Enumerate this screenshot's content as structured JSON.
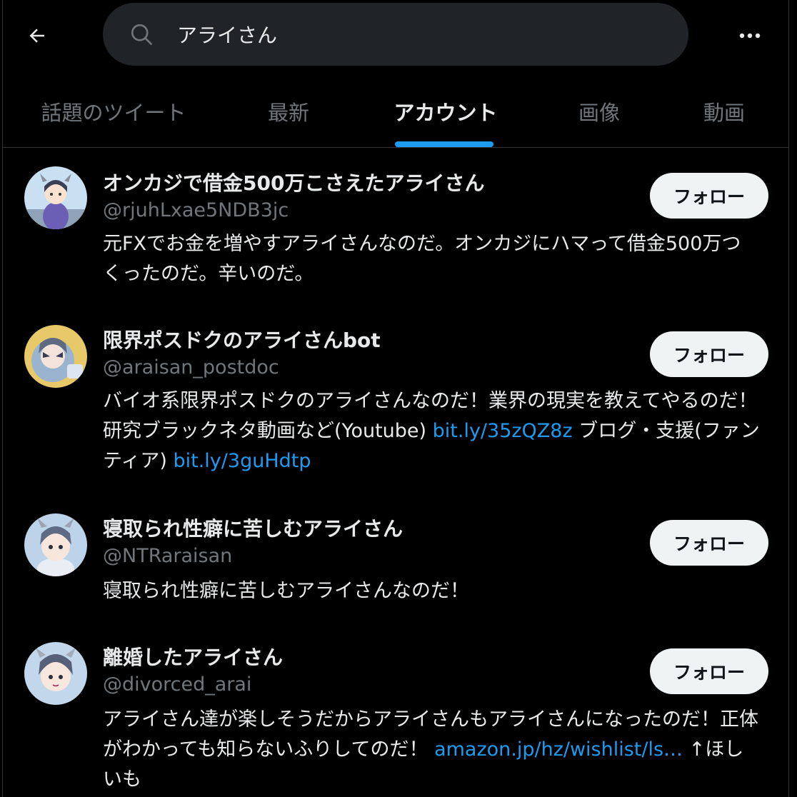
{
  "header": {
    "back_icon": "arrow-left-icon",
    "search_icon": "search-icon",
    "search_value": "アライさん",
    "more_icon": "more-horizontal-icon"
  },
  "tabs": [
    {
      "label": "話題のツイート",
      "active": false
    },
    {
      "label": "最新",
      "active": false
    },
    {
      "label": "アカウント",
      "active": true
    },
    {
      "label": "画像",
      "active": false
    },
    {
      "label": "動画",
      "active": false
    }
  ],
  "colors": {
    "background": "#000000",
    "accent": "#1d9bf0",
    "text_primary": "#e7e9ea",
    "text_secondary": "#71767b",
    "follow_button_bg": "#eff3f4"
  },
  "users": [
    {
      "name": "オンカジで借金500万こさえたアライさん",
      "handle": "@rjuhLxae5NDB3jc",
      "bio": [
        {
          "text": "元FXでお金を増やすアライさんなのだ。オンカジにハマって借金500万つくったのだ。辛いのだ。",
          "link": false
        }
      ],
      "follow_label": "フォロー"
    },
    {
      "name": "限界ポスドクのアライさんbot",
      "handle": "@araisan_postdoc",
      "bio": [
        {
          "text": "バイオ系限界ポスドクのアライさんなのだ！業界の現実を教えてやるのだ！ 研究ブラックネタ動画など(Youtube) ",
          "link": false
        },
        {
          "text": "bit.ly/35zQZ8z",
          "link": true
        },
        {
          "text": " ブログ・支援(ファンティア) ",
          "link": false
        },
        {
          "text": "bit.ly/3guHdtp",
          "link": true
        }
      ],
      "follow_label": "フォロー"
    },
    {
      "name": "寝取られ性癖に苦しむアライさん",
      "handle": "@NTRaraisan",
      "bio": [
        {
          "text": "寝取られ性癖に苦しむアライさんなのだ！",
          "link": false
        }
      ],
      "follow_label": "フォロー"
    },
    {
      "name": "離婚したアライさん",
      "handle": "@divorced_arai",
      "bio": [
        {
          "text": "アライさん達が楽しそうだからアライさんもアライさんになったのだ！正体がわかっても知らないふりしてのだ！ ",
          "link": false
        },
        {
          "text": "amazon.jp/hz/wishlist/ls…",
          "link": true
        },
        {
          "text": " ↑ほしいも",
          "link": false
        }
      ],
      "follow_label": "フォロー"
    }
  ]
}
